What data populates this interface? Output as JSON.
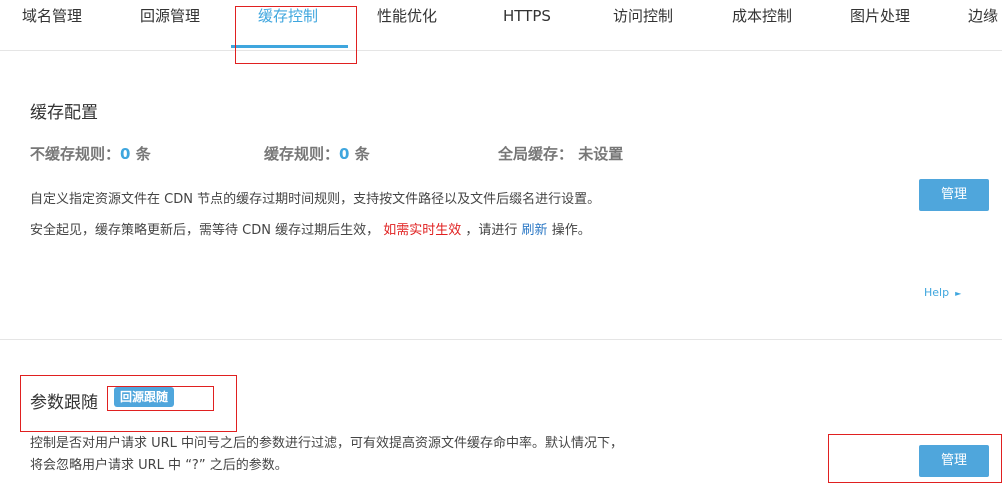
{
  "tabs": [
    {
      "label": "域名管理"
    },
    {
      "label": "回源管理"
    },
    {
      "label": "缓存控制"
    },
    {
      "label": "性能优化"
    },
    {
      "label": "HTTPS"
    },
    {
      "label": "访问控制"
    },
    {
      "label": "成本控制"
    },
    {
      "label": "图片处理"
    },
    {
      "label": "边缘"
    }
  ],
  "active_tab": "缓存控制",
  "cache_config": {
    "title": "缓存配置",
    "no_cache_rules": {
      "label": "不缓存规则：",
      "count": "0",
      "unit": "条"
    },
    "cache_rules": {
      "label": "缓存规则：",
      "count": "0",
      "unit": "条"
    },
    "global_cache": {
      "label": "全局缓存：",
      "value": "未设置"
    },
    "desc1": "自定义指定资源文件在 CDN 节点的缓存过期时间规则，支持按文件路径以及文件后缀名进行设置。",
    "desc2_pre": "安全起见，缓存策略更新后，需等待 CDN 缓存过期后生效，",
    "desc2_warn": "如需实时生效",
    "desc2_mid": "，请进行",
    "desc2_link": "刷新",
    "desc2_post": "操作。",
    "manage_button": "管理",
    "help_link": "Help"
  },
  "param_follow": {
    "title": "参数跟随",
    "badge": "回源跟随",
    "desc1": "控制是否对用户请求 URL 中问号之后的参数进行过滤，可有效提高资源文件缓存命中率。默认情况下，",
    "desc2": "将会忽略用户请求 URL 中 “?” 之后的参数。",
    "manage_button": "管理"
  },
  "colors": {
    "accent": "#3fa6de",
    "button": "#4fa6dc",
    "warning": "#e02020",
    "annotation_box": "#e02020"
  }
}
